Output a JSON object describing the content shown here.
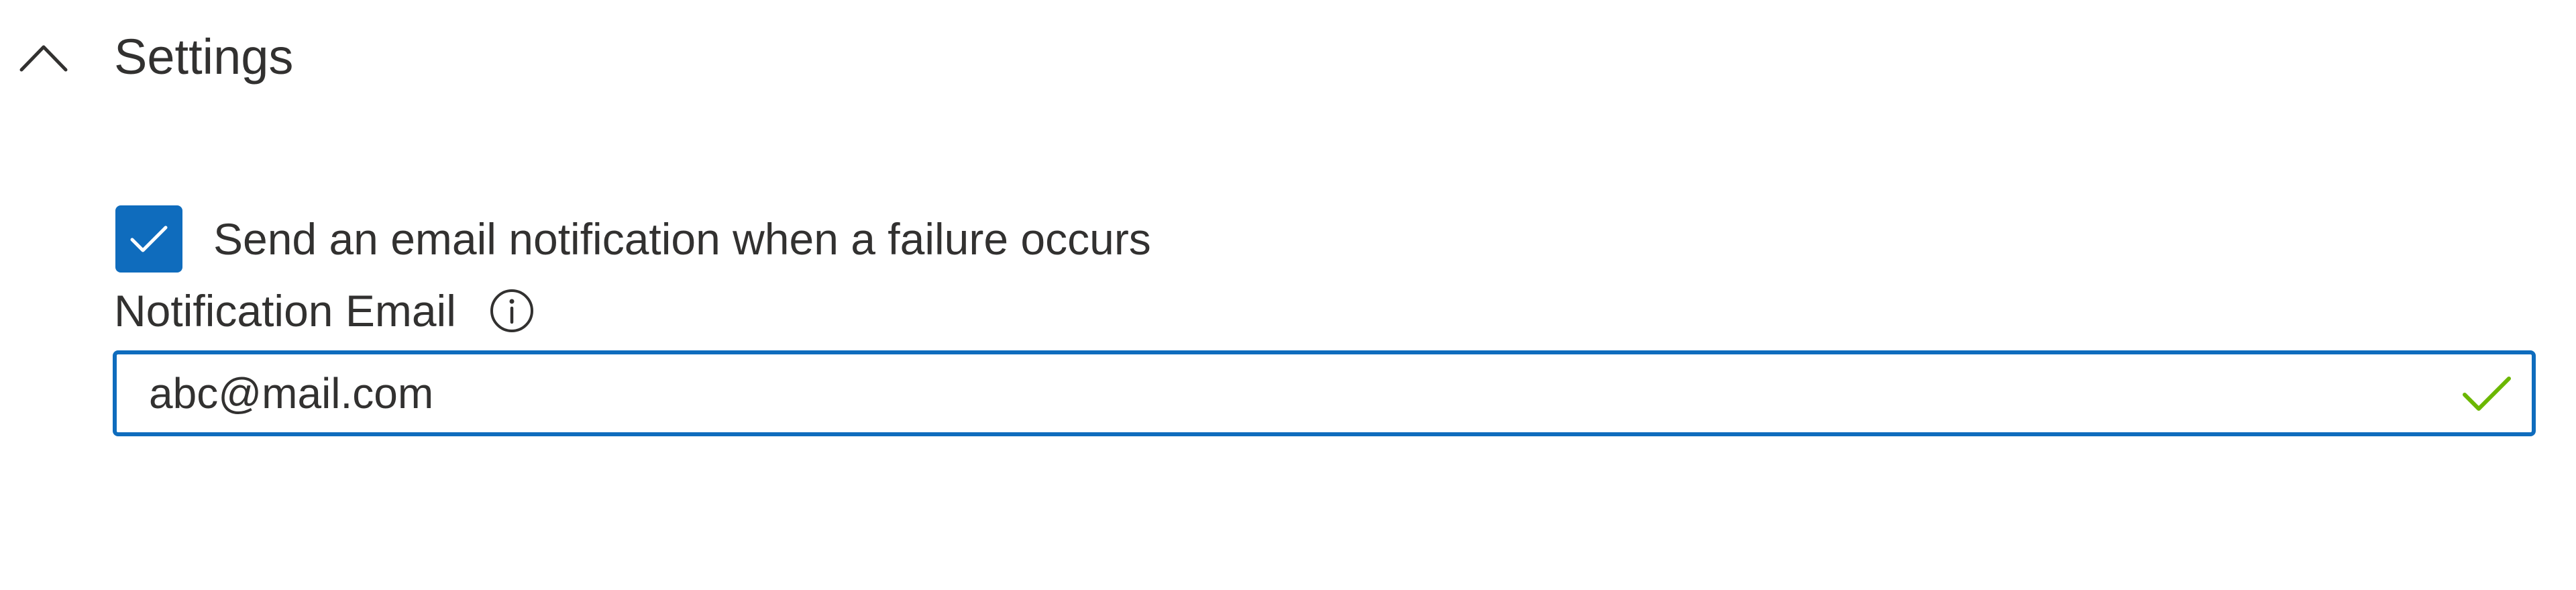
{
  "settings": {
    "title": "Settings",
    "expanded": true,
    "chevron_icon": "chevron-up-icon"
  },
  "notification": {
    "checkbox_label": "Send an email notification when a failure occurs",
    "checked": true,
    "checkbox_icon": "checkmark-icon",
    "email_label": "Notification Email",
    "info_icon": "info-icon",
    "email_value": "abc@mail.com",
    "valid_icon": "checkmark-icon"
  },
  "colors": {
    "accent": "#0f6cbd",
    "text": "#323130",
    "valid": "#6bb700"
  }
}
